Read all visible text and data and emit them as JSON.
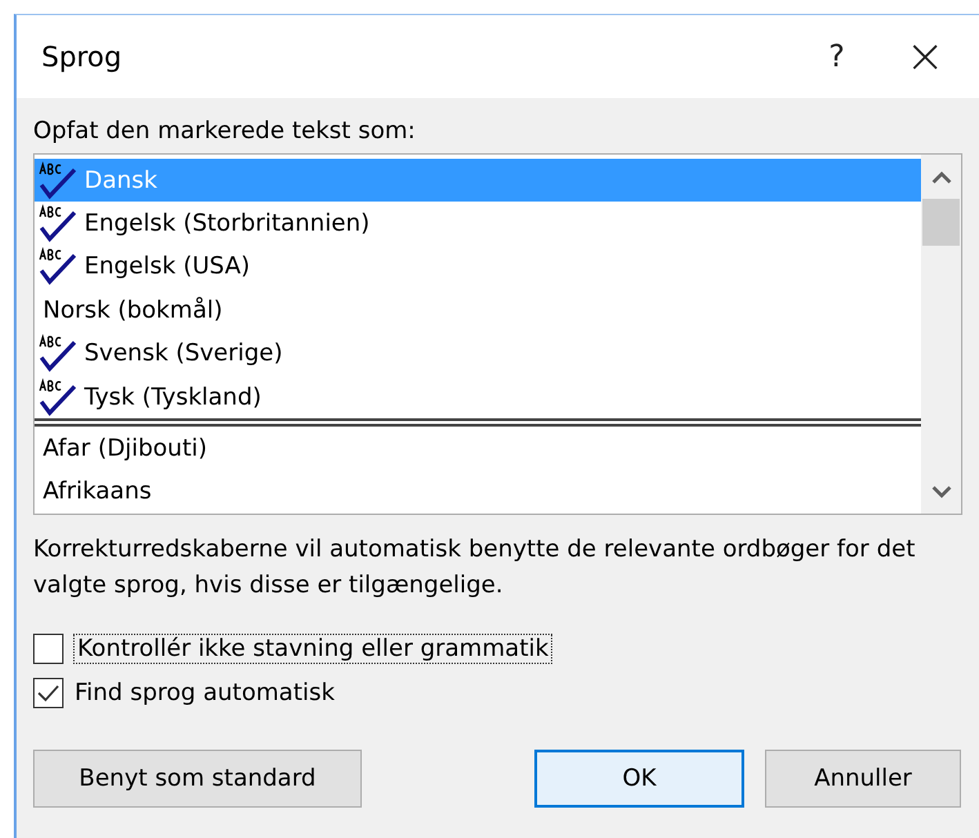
{
  "window": {
    "title": "Sprog",
    "help": "?",
    "close": "×"
  },
  "list_label": "Opfat den markerede tekst som:",
  "languages": [
    {
      "kind": "language",
      "label": "Dansk",
      "spelling": true,
      "selected": true
    },
    {
      "kind": "language",
      "label": "Engelsk (Storbritannien)",
      "spelling": true,
      "selected": false
    },
    {
      "kind": "language",
      "label": "Engelsk (USA)",
      "spelling": true,
      "selected": false
    },
    {
      "kind": "language",
      "label": "Norsk (bokmål)",
      "spelling": false,
      "selected": false
    },
    {
      "kind": "language",
      "label": "Svensk (Sverige)",
      "spelling": true,
      "selected": false
    },
    {
      "kind": "language",
      "label": "Tysk (Tyskland)",
      "spelling": true,
      "selected": false
    },
    {
      "kind": "separator"
    },
    {
      "kind": "language",
      "label": "Afar (Djibouti)",
      "spelling": false,
      "selected": false
    },
    {
      "kind": "language",
      "label": "Afrikaans",
      "spelling": false,
      "selected": false
    }
  ],
  "note": "Korrekturredskaberne vil automatisk benytte de relevante ordbøger for det valgte sprog, hvis disse er tilgængelige.",
  "options": [
    {
      "label": "Kontrollér ikke stavning eller grammatik",
      "checked": false,
      "focused": true
    },
    {
      "label": "Find sprog automatisk",
      "checked": true,
      "focused": false
    }
  ],
  "buttons": [
    {
      "label": "Benyt som standard",
      "default": false
    },
    {
      "label": "OK",
      "default": true
    },
    {
      "label": "Annuller",
      "default": false
    }
  ]
}
